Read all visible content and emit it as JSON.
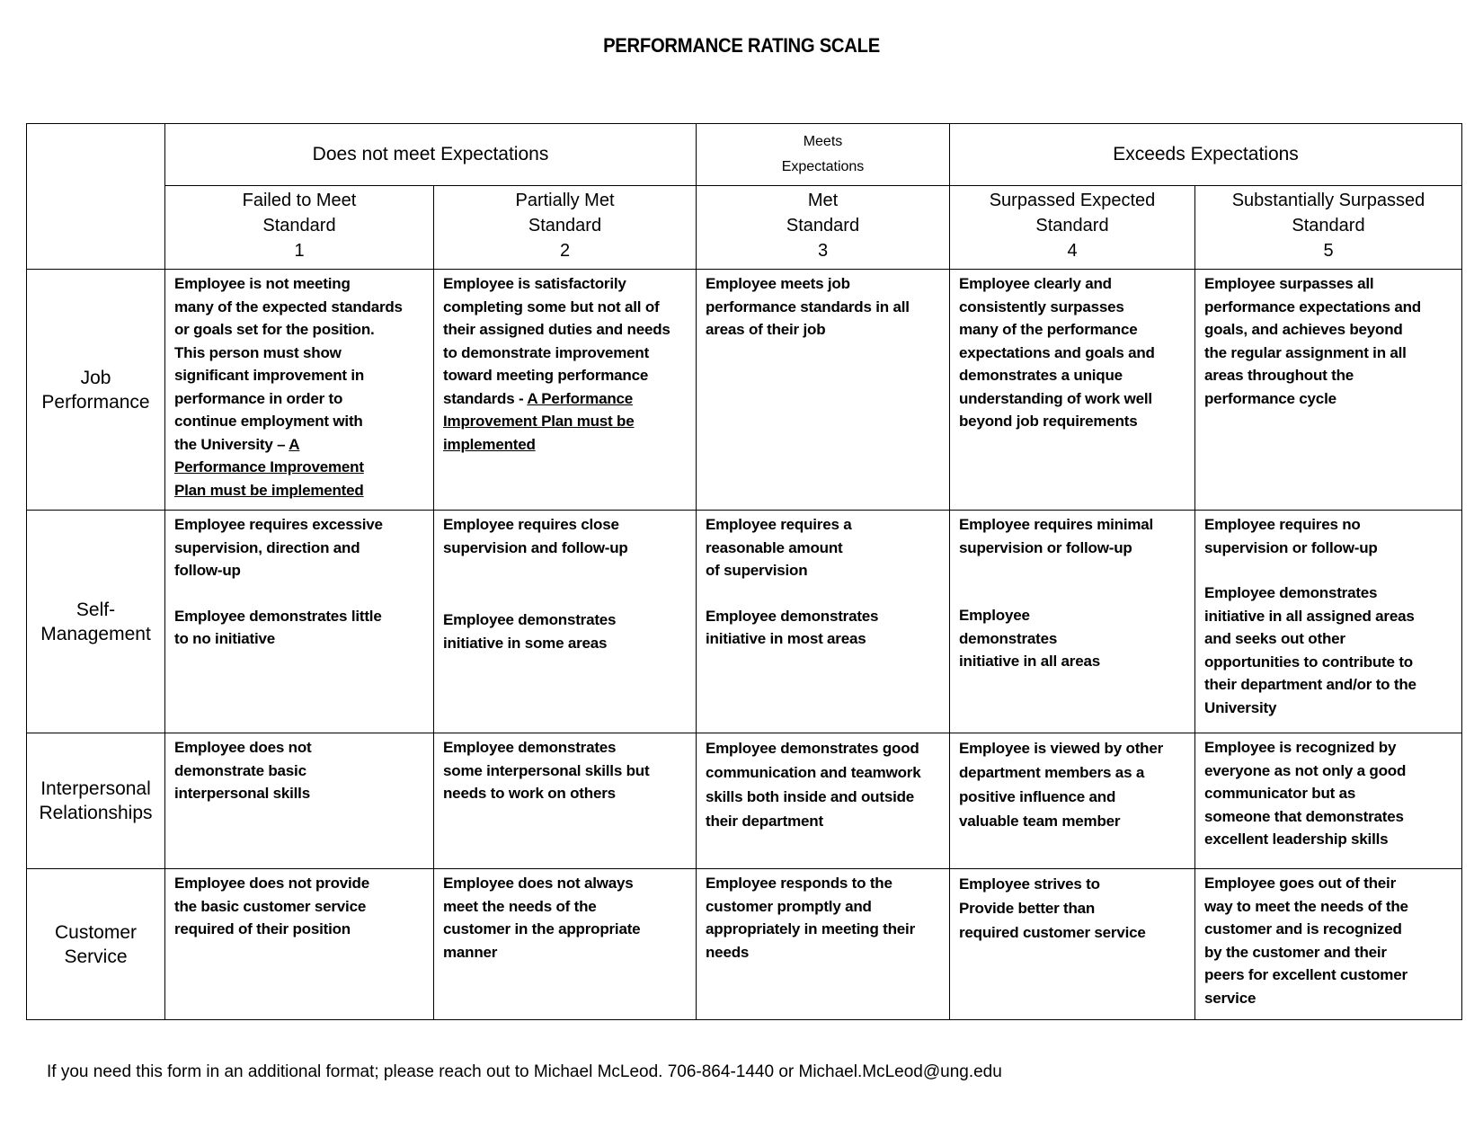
{
  "title": "PERFORMANCE RATING SCALE",
  "groups": {
    "does_not_meet": "Does not meet Expectations",
    "meets": "Meets\nExpectations",
    "exceeds": "Exceeds Expectations"
  },
  "levels": [
    {
      "label": "Failed to Meet\nStandard",
      "number": "1"
    },
    {
      "label": "Partially Met\nStandard",
      "number": "2"
    },
    {
      "label": "Met\nStandard",
      "number": "3"
    },
    {
      "label": "Surpassed Expected\nStandard",
      "number": "4"
    },
    {
      "label": "Substantially Surpassed\nStandard",
      "number": "5"
    }
  ],
  "rows": [
    {
      "label": "Job\nPerformance",
      "cells": [
        {
          "text": "Employee is not meeting\nmany of the expected standards\nor goals set for the position.\nThis person must show\nsignificant improvement in\nperformance in order to\ncontinue employment with\nthe University – ",
          "underlined": "A\nPerformance Improvement\nPlan must be implemented"
        },
        {
          "text": "Employee is satisfactorily\ncompleting some but not all of\ntheir assigned duties and needs\nto demonstrate improvement\ntoward meeting performance\nstandards - ",
          "underlined": "A Performance\nImprovement Plan must be\nimplemented"
        },
        {
          "text": "Employee meets job\nperformance standards in all\nareas of their job"
        },
        {
          "text": "Employee clearly and\nconsistently surpasses\nmany of the performance\nexpectations and goals and\ndemonstrates a unique\nunderstanding of work well\nbeyond job requirements"
        },
        {
          "text": "Employee surpasses all\nperformance expectations and\ngoals, and achieves beyond\nthe regular assignment in all\nareas throughout the\nperformance cycle"
        }
      ]
    },
    {
      "label": "Self-\nManagement",
      "cells": [
        {
          "p1": "Employee requires excessive\nsupervision, direction and\nfollow-up",
          "p2": "Employee demonstrates little\nto no initiative"
        },
        {
          "p1": "Employee requires close\nsupervision and follow-up",
          "p2": "Employee demonstrates\ninitiative in some areas"
        },
        {
          "p1": "Employee requires a\nreasonable amount\nof supervision",
          "p2": "Employee demonstrates\ninitiative in most areas"
        },
        {
          "p1": "Employee requires minimal\nsupervision or follow-up",
          "p2": "Employee\ndemonstrates\ninitiative in all areas"
        },
        {
          "p1": "Employee requires no\nsupervision or follow-up",
          "p2": "Employee demonstrates\ninitiative in all assigned areas\nand seeks out other\nopportunities to contribute to\ntheir department and/or to the\nUniversity"
        }
      ]
    },
    {
      "label": "Interpersonal\nRelationships",
      "cells": [
        {
          "text": "Employee does not\ndemonstrate basic\ninterpersonal skills"
        },
        {
          "text": "Employee demonstrates\nsome interpersonal skills but\nneeds to work on others"
        },
        {
          "text": "Employee demonstrates good\ncommunication and teamwork\nskills both inside and outside\ntheir department"
        },
        {
          "text": "Employee is viewed by other\ndepartment members as a\npositive influence and\nvaluable team member"
        },
        {
          "text": "Employee is recognized by\neveryone as not only a good\ncommunicator but as\nsomeone that demonstrates\nexcellent leadership skills"
        }
      ]
    },
    {
      "label": "Customer\nService",
      "cells": [
        {
          "text": "Employee does not provide\nthe basic customer service\nrequired of their position"
        },
        {
          "text": "Employee does not always\nmeet the needs of the\ncustomer in the appropriate\nmanner"
        },
        {
          "text": "Employee responds to the\ncustomer promptly and\nappropriately in meeting their\nneeds"
        },
        {
          "text": "Employee strives to\nProvide better than\nrequired customer service"
        },
        {
          "text": "Employee goes out of their\nway to meet the needs of the\ncustomer and is recognized\nby the customer and their\npeers for excellent customer\nservice"
        }
      ]
    }
  ],
  "footer": {
    "text": "If you need this form in an additional format; please reach out to Michael McLeod. 706-864-1440 or ",
    "email": "Michael.McLeod@ung.edu"
  }
}
